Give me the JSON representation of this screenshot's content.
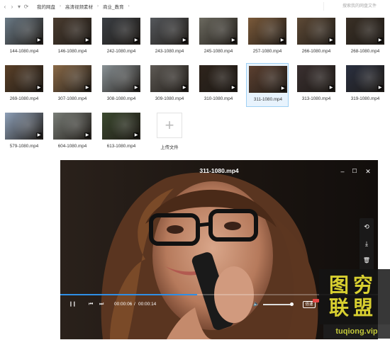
{
  "topbar": {
    "back_glyph": "‹",
    "forward_glyph": "›",
    "dropdown_glyph": "▾",
    "refresh_glyph": "⟳",
    "breadcrumbs": [
      "我的网盘",
      "高清视频素材",
      "商业_教育"
    ],
    "separator": "›",
    "search_placeholder": "搜索我的网盘文件"
  },
  "files": [
    {
      "name": "144-1080.mp4",
      "tone": "#6b7a86"
    },
    {
      "name": "146-1080.mp4",
      "tone": "#4a3c30"
    },
    {
      "name": "242-1080.mp4",
      "tone": "#3b3f44"
    },
    {
      "name": "243-1080.mp4",
      "tone": "#55585c"
    },
    {
      "name": "245-1080.mp4",
      "tone": "#6c6a60"
    },
    {
      "name": "257-1080.mp4",
      "tone": "#7b5a3a"
    },
    {
      "name": "266-1080.mp4",
      "tone": "#5e4a36"
    },
    {
      "name": "268-1080.mp4",
      "tone": "#3a3026"
    },
    {
      "name": "269-1080.mp4",
      "tone": "#5a4028"
    },
    {
      "name": "307-1080.mp4",
      "tone": "#8a6a48"
    },
    {
      "name": "308-1080.mp4",
      "tone": "#8a9296"
    },
    {
      "name": "309-1080.mp4",
      "tone": "#5e5a55"
    },
    {
      "name": "310-1080.mp4",
      "tone": "#2e241c"
    },
    {
      "name": "311-1080.mp4",
      "tone": "#5c4030",
      "selected": true
    },
    {
      "name": "313-1080.mp4",
      "tone": "#3a3030"
    },
    {
      "name": "319-1080.mp4",
      "tone": "#2a3040"
    },
    {
      "name": "579-1080.mp4",
      "tone": "#8ea0b8"
    },
    {
      "name": "604-1080.mp4",
      "tone": "#7a7e78"
    },
    {
      "name": "613-1080.mp4",
      "tone": "#3c4a30"
    }
  ],
  "upload": {
    "label": "上传文件",
    "glyph": "+"
  },
  "player": {
    "title": "311-1080.mp4",
    "minimize_glyph": "–",
    "maximize_glyph": "☐",
    "close_glyph": "✕",
    "share_glyph": "⟲",
    "download_glyph": "⤓",
    "delete_glyph": "🗑",
    "current_time": "00:00:06",
    "total_time": "00:00:14",
    "time_separator": "/",
    "progress": 0.43,
    "volume": 0.95,
    "pause_glyph": "❙❙",
    "prev_glyph": "⏮",
    "next_glyph": "⏭",
    "volume_glyph": "🔈",
    "speed_label": "倍速",
    "accent_color": "#2f8fe6"
  },
  "watermark": {
    "line1": "图穷",
    "line2": "联盟",
    "url": "tuqiong.vip"
  }
}
